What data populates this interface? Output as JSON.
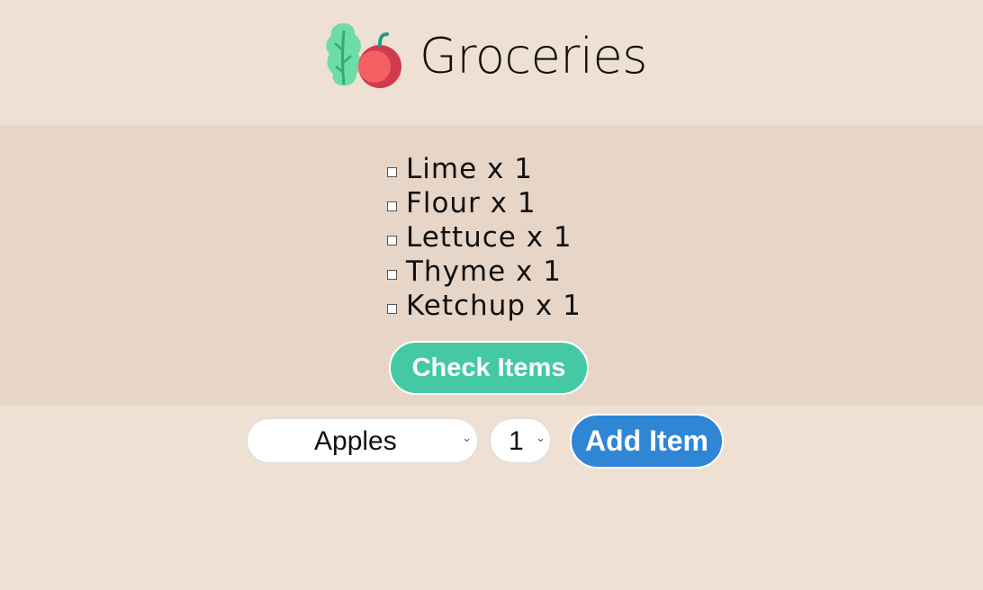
{
  "header": {
    "title": "Groceries",
    "logo_icon": "groceries-logo-icon"
  },
  "list": {
    "items": [
      {
        "label": "Lime x 1",
        "checked": false
      },
      {
        "label": "Flour x 1",
        "checked": false
      },
      {
        "label": "Lettuce x 1",
        "checked": false
      },
      {
        "label": "Thyme x 1",
        "checked": false
      },
      {
        "label": "Ketchup x 1",
        "checked": false
      }
    ],
    "check_button_label": "Check Items"
  },
  "add_form": {
    "product_selected": "Apples",
    "quantity_selected": "1",
    "add_button_label": "Add Item"
  },
  "colors": {
    "background": "#EEE1D3",
    "panel": "#E7D6C8",
    "check_button": "#44C9A4",
    "add_button": "#2F86D5"
  }
}
